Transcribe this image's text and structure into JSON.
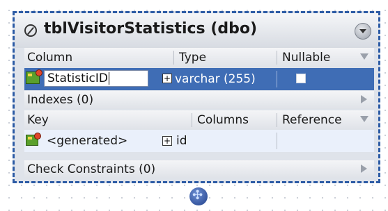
{
  "table": {
    "title": "tblVisitorStatistics (dbo)"
  },
  "columns_header": {
    "column": "Column",
    "type": "Type",
    "nullable": "Nullable"
  },
  "column_row": {
    "name": "StatisticID",
    "type": "varchar (255)",
    "nullable": false
  },
  "indexes": {
    "label": "Indexes (0)"
  },
  "keys_header": {
    "key": "Key",
    "columns": "Columns",
    "reference": "Reference"
  },
  "key_row": {
    "name": "<generated>",
    "columns": "id"
  },
  "check_constraints": {
    "label": "Check Constraints (0)"
  },
  "icons": {
    "title": "pencil-circle-icon",
    "collapse": "chevron-down-icon",
    "key": "primary-key-icon",
    "add": "plus-icon",
    "connector": "move-handle-icon"
  },
  "colors": {
    "border": "#2c5ba5",
    "selected_row": "#3f6db5",
    "panel": "#dfe3ea"
  }
}
